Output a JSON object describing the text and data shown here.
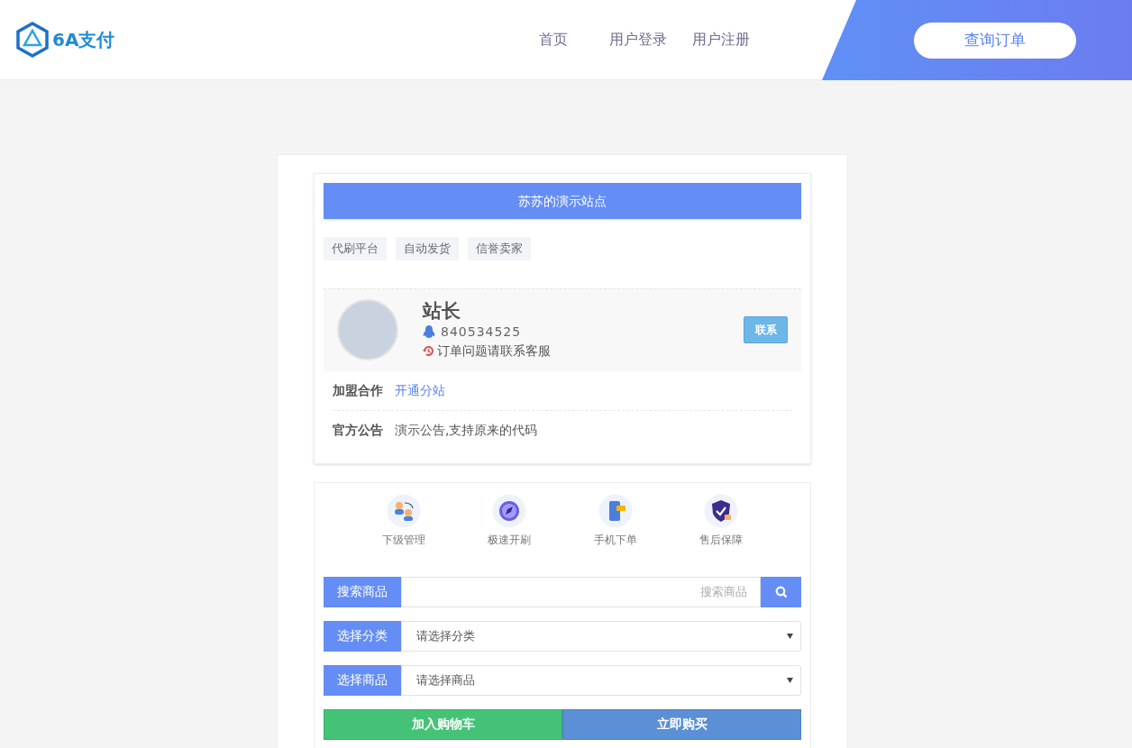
{
  "header": {
    "logo_text": "6A支付",
    "nav": [
      {
        "label": "首页",
        "selected": false
      },
      {
        "label": "用户登录",
        "selected": false
      },
      {
        "label": "用户注册",
        "selected": false
      }
    ],
    "query_button": "查询订单"
  },
  "site": {
    "title": "苏苏的演示站点",
    "tags": [
      "代刷平台",
      "自动发货",
      "信誉卖家"
    ],
    "owner": {
      "name": "站长",
      "qq": "840534525",
      "note": "订单问题请联系客服",
      "contact_button": "联系"
    },
    "info_rows": [
      {
        "label": "加盟合作",
        "value": "开通分站",
        "kind": "link"
      },
      {
        "label": "官方公告",
        "value": "演示公告,支持原来的代码",
        "kind": "text"
      }
    ]
  },
  "features": [
    {
      "label": "下级管理",
      "kind": "users"
    },
    {
      "label": "极速开刷",
      "kind": "rocket"
    },
    {
      "label": "手机下单",
      "kind": "phone"
    },
    {
      "label": "售后保障",
      "kind": "shield"
    }
  ],
  "form": {
    "search": {
      "label": "搜索商品",
      "placeholder": "搜索商品"
    },
    "selects": [
      {
        "label": "选择分类",
        "value": "请选择分类"
      },
      {
        "label": "选择商品",
        "value": "请选择商品"
      }
    ],
    "buttons": [
      {
        "label": "加入购物车",
        "kind": "cart"
      },
      {
        "label": "立即购买",
        "kind": "buy"
      }
    ]
  }
}
